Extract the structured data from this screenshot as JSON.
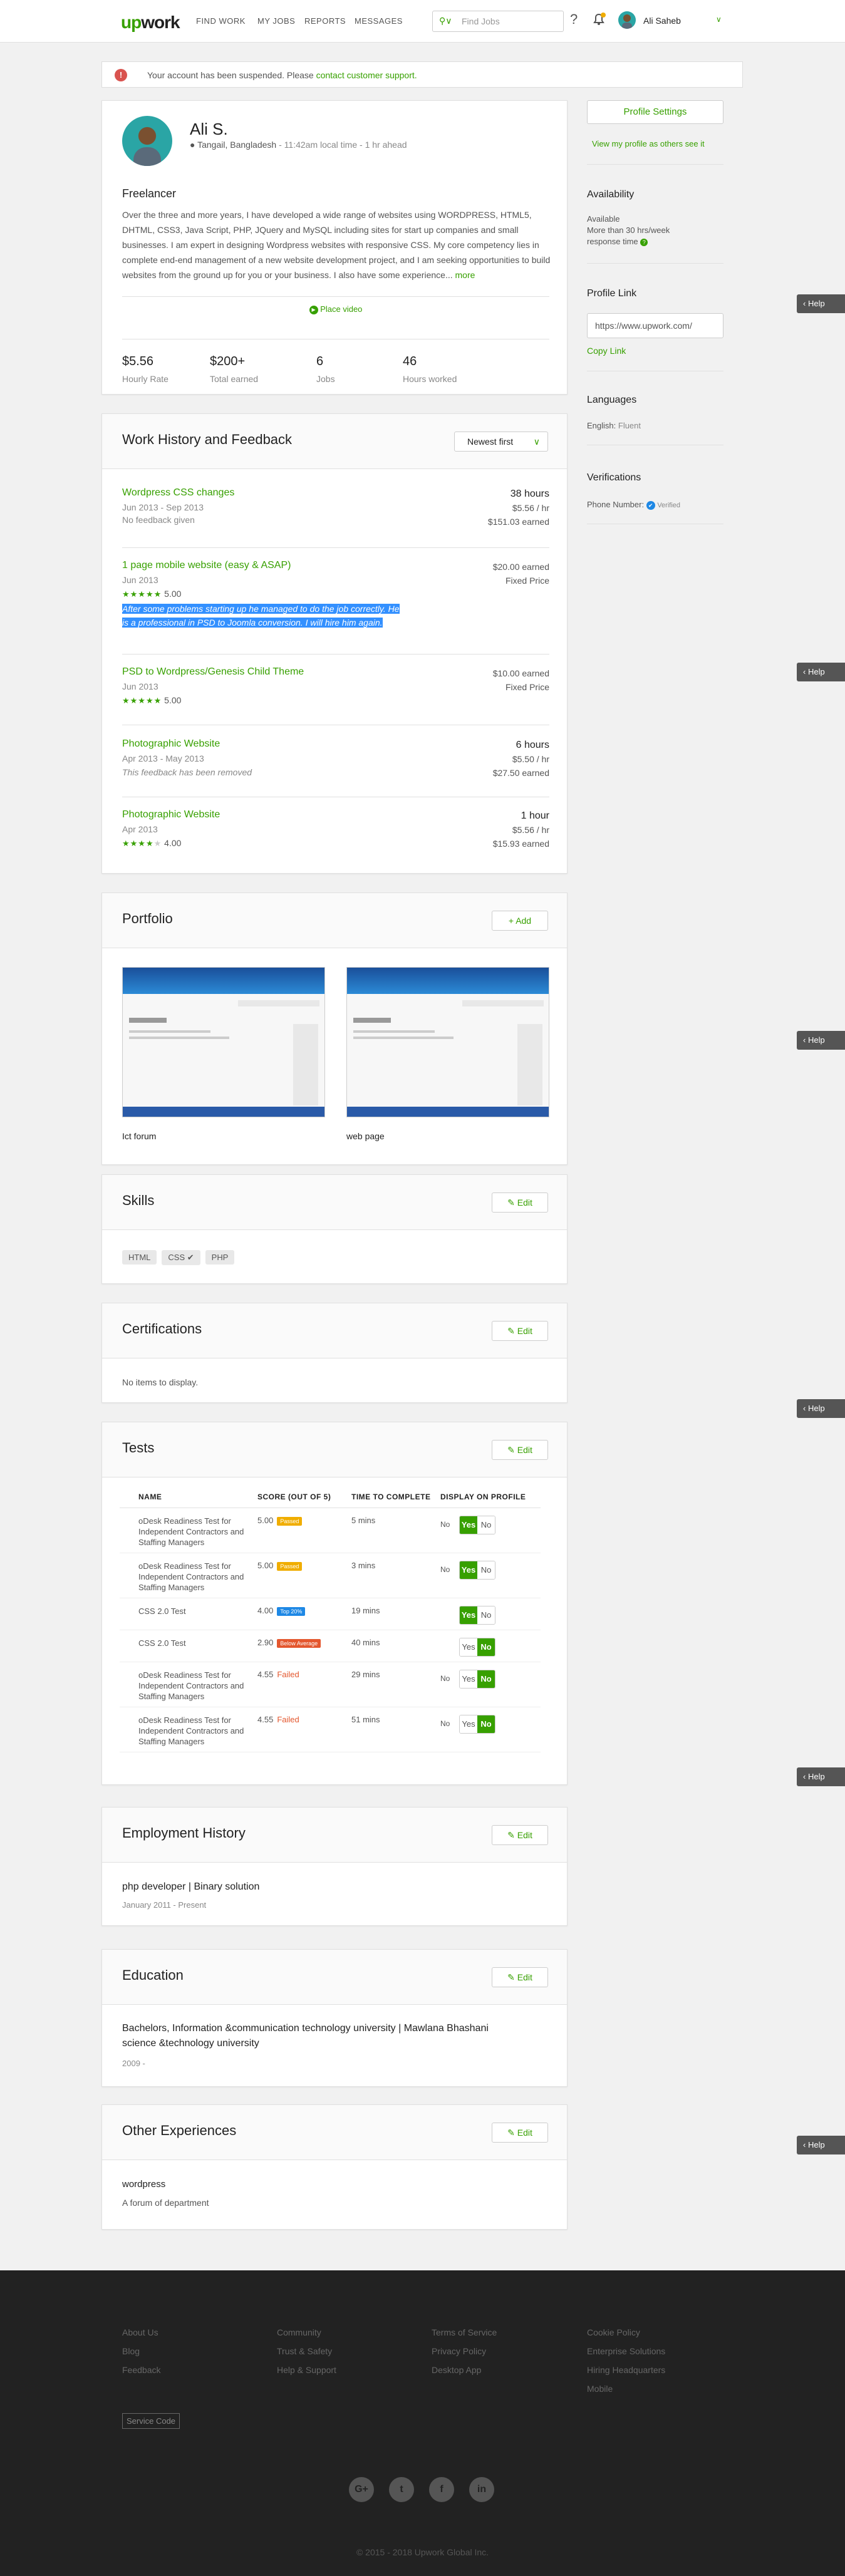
{
  "header": {
    "logo_main": "up",
    "logo_tail": "work",
    "nav": [
      "FIND WORK",
      "MY JOBS",
      "REPORTS",
      "MESSAGES"
    ],
    "search_placeholder": "Find Jobs",
    "help_glyph": "?",
    "user_name": "Ali Saheb"
  },
  "alert": {
    "text": "Your account has been suspended. Please",
    "link": "contact customer support."
  },
  "profile": {
    "name": "Ali S.",
    "location": "Tangail, Bangladesh",
    "local_time": " - 11:42am local time - 1 hr ahead",
    "title": "Freelancer",
    "description": "Over the three and more years, I have developed a wide range of websites using WORDPRESS, HTML5, DHTML, CSS3, Java Script, PHP, JQuery and MySQL including sites for start up companies and small businesses. I am expert in designing Wordpress websites with responsive CSS. My core competency lies in complete end-end management of a new website development project, and I am seeking opportunities to build websites from the ground up for you or your business. I also have some experience...",
    "more": "more",
    "place_video": "Place video",
    "stats": [
      {
        "value": "$5.56",
        "label": "Hourly Rate"
      },
      {
        "value": "$200+",
        "label": "Total earned"
      },
      {
        "value": "6",
        "label": "Jobs"
      },
      {
        "value": "46",
        "label": "Hours worked"
      }
    ]
  },
  "work_history": {
    "title": "Work History and Feedback",
    "sort": "Newest first",
    "items": [
      {
        "title": "Wordpress CSS changes",
        "dates": "Jun 2013 - Sep 2013",
        "feedback": "No feedback given",
        "r1": "38 hours",
        "r2": "$5.56 / hr",
        "r3": "$151.03 earned"
      },
      {
        "title": "1 page mobile website (easy & ASAP)",
        "dates": "Jun 2013",
        "rating": "5.00",
        "comment": "After some problems starting up he managed to do the job correctly. He is a professional in PSD to Joomla conversion. I will hire him again.",
        "r1": "$20.00 earned",
        "r2": "Fixed Price"
      },
      {
        "title": "PSD to Wordpress/Genesis Child Theme",
        "dates": "Jun 2013",
        "rating": "5.00",
        "r1": "$10.00 earned",
        "r2": "Fixed Price"
      },
      {
        "title": "Photographic Website",
        "dates": "Apr 2013 - May 2013",
        "feedback": "This feedback has been removed",
        "r1": "6 hours",
        "r2": "$5.50 / hr",
        "r3": "$27.50 earned"
      },
      {
        "title": "Photographic Website",
        "dates": "Apr 2013",
        "rating": "4.00",
        "r1": "1 hour",
        "r2": "$5.56 / hr",
        "r3": "$15.93 earned"
      }
    ]
  },
  "portfolio": {
    "title": "Portfolio",
    "add": "Add",
    "items": [
      {
        "caption": "Ict forum"
      },
      {
        "caption": "web page"
      }
    ]
  },
  "skills": {
    "title": "Skills",
    "edit": "Edit",
    "tags": [
      "HTML",
      "CSS",
      "PHP"
    ]
  },
  "certifications": {
    "title": "Certifications",
    "edit": "Edit",
    "empty": "No items to display."
  },
  "tests": {
    "title": "Tests",
    "edit": "Edit",
    "columns": [
      "NAME",
      "SCORE (OUT OF 5)",
      "TIME TO COMPLETE",
      "DISPLAY ON PROFILE"
    ],
    "rows": [
      {
        "name": "oDesk Readiness Test for Independent Contractors and Staffing Managers",
        "score": "5.00",
        "badge": "Passed",
        "badge_color": "#f0ad00",
        "time": "5 mins",
        "display": "No",
        "selected": "Yes"
      },
      {
        "name": "oDesk Readiness Test for Independent Contractors and Staffing Managers",
        "score": "5.00",
        "badge": "Passed",
        "badge_color": "#f0ad00",
        "time": "3 mins",
        "display": "No",
        "selected": "Yes"
      },
      {
        "name": "CSS 2.0 Test",
        "score": "4.00",
        "badge": "Top 20%",
        "badge_color": "#1e88e5",
        "time": "19 mins",
        "display": "",
        "selected": "Yes"
      },
      {
        "name": "CSS 2.0 Test",
        "score": "2.90",
        "badge": "Below Average",
        "badge_color": "#e4572e",
        "time": "40 mins",
        "display": "",
        "selected": "No"
      },
      {
        "name": "oDesk Readiness Test for Independent Contractors and Staffing Managers",
        "score": "4.55",
        "badge": "Failed",
        "badge_color": "",
        "time": "29 mins",
        "display": "No",
        "selected": "No"
      },
      {
        "name": "oDesk Readiness Test for Independent Contractors and Staffing Managers",
        "score": "4.55",
        "badge": "Failed",
        "badge_color": "",
        "time": "51 mins",
        "display": "No",
        "selected": "No"
      }
    ],
    "yes": "Yes",
    "no": "No"
  },
  "employment": {
    "title": "Employment History",
    "edit": "Edit",
    "role": "php developer | Binary solution",
    "dates": "January 2011 - Present"
  },
  "education": {
    "title": "Education",
    "edit": "Edit",
    "degree": "Bachelors, Information &communication technology university | Mawlana Bhashani science &technology university",
    "dates": "2009 -"
  },
  "other": {
    "title": "Other Experiences",
    "edit": "Edit",
    "heading": "wordpress",
    "text": "A forum of department"
  },
  "sidebar": {
    "settings": "Profile Settings",
    "view_as": "View my profile as others see it",
    "availability_title": "Availability",
    "availability_1": "Available",
    "availability_2": "More than 30 hrs/week",
    "availability_3": "response time",
    "profile_link_title": "Profile Link",
    "profile_link": "https://www.upwork.com/",
    "copy_link": "Copy Link",
    "languages_title": "Languages",
    "language": "English:",
    "language_level": "Fluent",
    "verifications_title": "Verifications",
    "phone": "Phone Number:",
    "verified": "Verified"
  },
  "help_label": "Help",
  "footer": {
    "col1": [
      "About Us",
      "Blog",
      "Feedback"
    ],
    "col2": [
      "Community",
      "Trust & Safety",
      "Help & Support"
    ],
    "col3": [
      "Terms of Service",
      "Privacy Policy",
      "Desktop App"
    ],
    "col4": [
      "Cookie Policy",
      "Enterprise Solutions",
      "Hiring Headquarters",
      "Mobile"
    ],
    "service_code": "Service Code",
    "social": [
      "G+",
      "t",
      "f",
      "in"
    ],
    "copyright": "© 2015 - 2018 Upwork Global Inc."
  }
}
